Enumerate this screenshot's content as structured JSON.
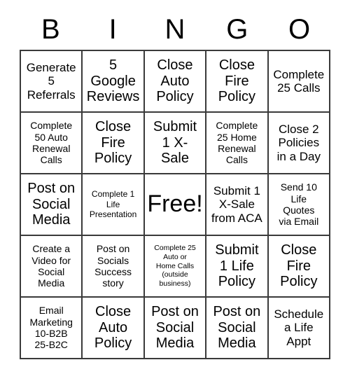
{
  "card": {
    "header_letters": [
      "B",
      "I",
      "N",
      "G",
      "O"
    ],
    "rows": [
      [
        {
          "text": "Generate\n5\nReferrals",
          "size": "md",
          "free": false
        },
        {
          "text": "5\nGoogle\nReviews",
          "size": "lg",
          "free": false
        },
        {
          "text": "Close\nAuto\nPolicy",
          "size": "lg",
          "free": false
        },
        {
          "text": "Close\nFire\nPolicy",
          "size": "lg",
          "free": false
        },
        {
          "text": "Complete\n25 Calls",
          "size": "md",
          "free": false
        }
      ],
      [
        {
          "text": "Complete\n50 Auto\nRenewal\nCalls",
          "size": "sm",
          "free": false
        },
        {
          "text": "Close\nFire\nPolicy",
          "size": "lg",
          "free": false
        },
        {
          "text": "Submit\n1 X-\nSale",
          "size": "lg",
          "free": false
        },
        {
          "text": "Complete\n25 Home\nRenewal\nCalls",
          "size": "sm",
          "free": false
        },
        {
          "text": "Close 2\nPolicies\nin a Day",
          "size": "md",
          "free": false
        }
      ],
      [
        {
          "text": "Post on\nSocial\nMedia",
          "size": "lg",
          "free": false
        },
        {
          "text": "Complete 1\nLife\nPresentation",
          "size": "xs",
          "free": false
        },
        {
          "text": "Free!",
          "size": "xl",
          "free": true
        },
        {
          "text": "Submit 1\nX-Sale\nfrom ACA",
          "size": "md",
          "free": false
        },
        {
          "text": "Send 10\nLife\nQuotes\nvia Email",
          "size": "sm",
          "free": false
        }
      ],
      [
        {
          "text": "Create a\nVideo for\nSocial\nMedia",
          "size": "sm",
          "free": false
        },
        {
          "text": "Post on\nSocials\nSuccess\nstory",
          "size": "sm",
          "free": false
        },
        {
          "text": "Complete 25\nAuto or\nHome Calls\n(outside\nbusiness)",
          "size": "xxs",
          "free": false
        },
        {
          "text": "Submit\n1 Life\nPolicy",
          "size": "lg",
          "free": false
        },
        {
          "text": "Close\nFire\nPolicy",
          "size": "lg",
          "free": false
        }
      ],
      [
        {
          "text": "Email\nMarketing\n10-B2B\n25-B2C",
          "size": "sm",
          "free": false
        },
        {
          "text": "Close\nAuto\nPolicy",
          "size": "lg",
          "free": false
        },
        {
          "text": "Post on\nSocial\nMedia",
          "size": "lg",
          "free": false
        },
        {
          "text": "Post on\nSocial\nMedia",
          "size": "lg",
          "free": false
        },
        {
          "text": "Schedule\na Life\nAppt",
          "size": "md",
          "free": false
        }
      ]
    ]
  },
  "colors": {
    "background": "#ffffff",
    "border": "#3a3a3a",
    "text": "#000000"
  }
}
